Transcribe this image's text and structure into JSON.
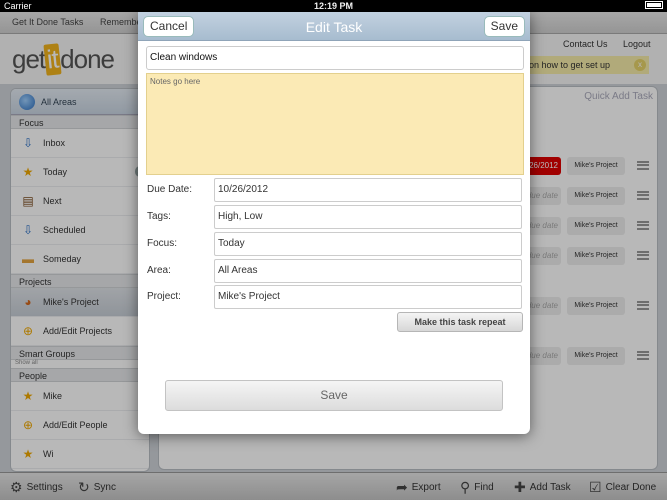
{
  "status_bar": {
    "carrier": "Carrier",
    "time": "12:19 PM"
  },
  "tabs": [
    "Get It Done Tasks",
    "Remembe"
  ],
  "logo": {
    "pre": "get",
    "mid": "it",
    "post": "done"
  },
  "header": {
    "contact": "Contact Us",
    "logout": "Logout",
    "setup_banner": "ns on how to get set up",
    "setup_close": "x"
  },
  "sidebar": {
    "all_areas": "All Areas",
    "focus_header": "Focus",
    "focus_items": [
      {
        "label": "Inbox",
        "icon": "inbox-icon",
        "glyph": "⇩"
      },
      {
        "label": "Today",
        "icon": "star-icon",
        "glyph": "★",
        "count": "6"
      },
      {
        "label": "Next",
        "icon": "book-icon",
        "glyph": "▤"
      },
      {
        "label": "Scheduled",
        "icon": "scheduled-icon",
        "glyph": "⇩"
      },
      {
        "label": "Someday",
        "icon": "folder-icon",
        "glyph": "▬"
      }
    ],
    "projects_header": "Projects",
    "project_items": [
      {
        "label": "Mike's Project",
        "icon": "project-pie-icon",
        "glyph": "◕"
      },
      {
        "label": "Add/Edit Projects",
        "icon": "add-icon",
        "glyph": "⊕"
      }
    ],
    "smart_groups_header": "Smart Groups",
    "show_all": "Show all",
    "people_header": "People",
    "people_items": [
      {
        "label": "Mike",
        "icon": "star-icon",
        "glyph": "★"
      },
      {
        "label": "Add/Edit People",
        "icon": "add-icon",
        "glyph": "⊕"
      },
      {
        "label": "Wi",
        "icon": "star-icon",
        "glyph": "★"
      }
    ]
  },
  "tasklist": {
    "quick_add_placeholder": "Quick Add Task",
    "rows": [
      {
        "due": "26/2012",
        "overdue": true,
        "project": "Mike's Project"
      },
      {
        "due": "due date",
        "overdue": false,
        "project": "Mike's Project"
      },
      {
        "due": "due date",
        "overdue": false,
        "project": "Mike's Project"
      },
      {
        "due": "due date",
        "overdue": false,
        "project": "Mike's Project"
      },
      {
        "due": "due date",
        "overdue": false,
        "project": "Mike's Project"
      },
      {
        "due": "due date",
        "overdue": false,
        "project": "Mike's Project"
      }
    ]
  },
  "bottom_bar": {
    "settings": "Settings",
    "sync": "Sync",
    "export": "Export",
    "find": "Find",
    "add_task": "Add Task",
    "clear_done": "Clear Done"
  },
  "modal": {
    "title": "Edit Task",
    "cancel": "Cancel",
    "save_top": "Save",
    "task_name": "Clean windows",
    "notes_placeholder": "Notes go here",
    "fields": [
      {
        "label": "Due Date:",
        "value": "10/26/2012"
      },
      {
        "label": "Tags:",
        "value": "High, Low"
      },
      {
        "label": "Focus:",
        "value": "Today"
      },
      {
        "label": "Area:",
        "value": "All Areas"
      },
      {
        "label": "Project:",
        "value": "Mike's Project"
      }
    ],
    "repeat_button": "Make this task repeat",
    "save_bottom": "Save"
  },
  "colors": {
    "notes_bg": "#fbeab5",
    "header_bar": "#b2c4d6",
    "overdue": "#e00000"
  }
}
